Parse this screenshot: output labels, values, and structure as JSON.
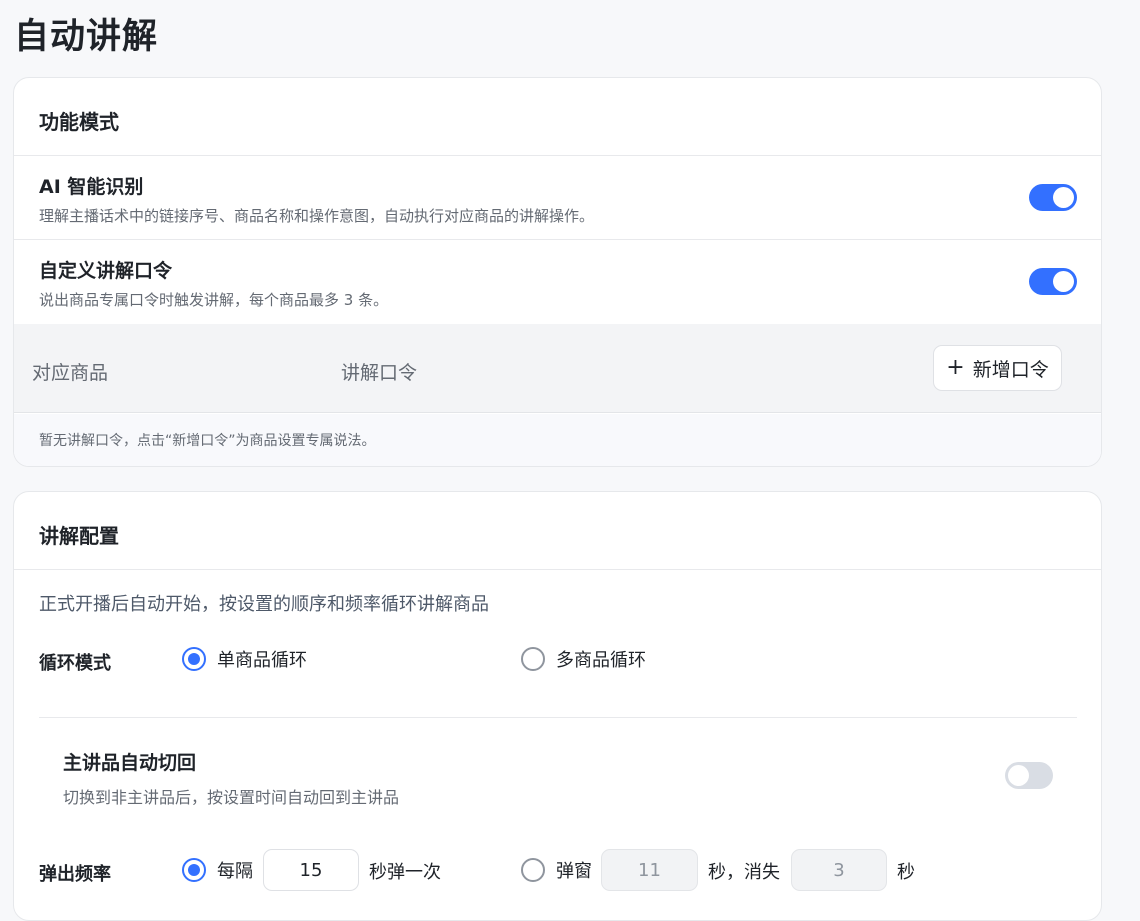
{
  "page": {
    "title": "自动讲解"
  },
  "mode_card": {
    "title": "功能模式",
    "ai": {
      "title": "AI 智能识别",
      "desc": "理解主播话术中的链接序号、商品名称和操作意图，自动执行对应商品的讲解操作。",
      "enabled": true
    },
    "custom": {
      "title": "自定义讲解口令",
      "desc": "说出商品专属口令时触发讲解，每个商品最多 3 条。",
      "enabled": true
    },
    "table": {
      "col_product": "对应商品",
      "col_command": "讲解口令",
      "add_button": "新增口令",
      "empty_note": "暂无讲解口令，点击“新增口令”为商品设置专属说法。"
    }
  },
  "config_card": {
    "title": "讲解配置",
    "intro": "正式开播后自动开始，按设置的顺序和频率循环讲解商品",
    "loop": {
      "label": "循环模式",
      "options": [
        "单商品循环",
        "多商品循环"
      ],
      "selected": "单商品循环"
    },
    "main_switch": {
      "title": "主讲品自动切回",
      "desc": "切换到非主讲品后，按设置时间自动回到主讲品",
      "enabled": false
    },
    "freq": {
      "label": "弹出频率",
      "opt1_prefix": "每隔",
      "opt1_value": "15",
      "opt1_suffix": "秒弹一次",
      "opt2_prefix": "弹窗",
      "opt2_value": "11",
      "opt2_mid": "秒，消失",
      "opt2_value2": "3",
      "opt2_suffix": "秒",
      "selected": "opt1"
    }
  },
  "colors": {
    "accent": "#3370ff",
    "toggle_off": "#d9dde4"
  }
}
